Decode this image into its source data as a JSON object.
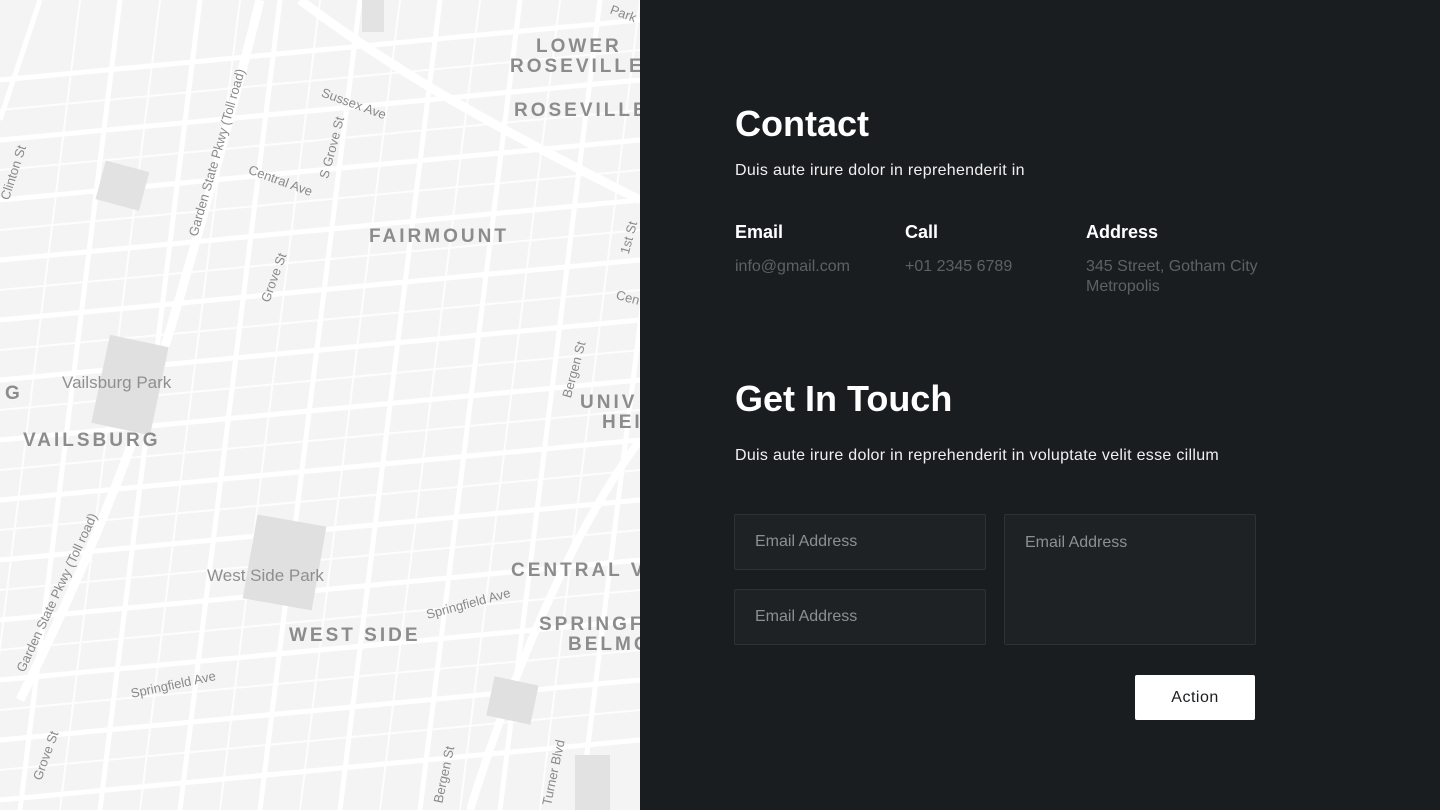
{
  "map": {
    "areas": [
      "LOWER",
      "ROSEVILLE",
      "ROSEVILLE",
      "FAIRMOUNT",
      "VAILSBURG",
      "CENTRAL V",
      "WEST SIDE",
      "SPRINGF",
      "BELMO",
      "UNIV",
      "HEI",
      "G"
    ],
    "parks": [
      "Vailsburg Park",
      "West Side Park"
    ],
    "streets": [
      "Park",
      "Sussex Ave",
      "S Grove St",
      "Garden State Pkwy (Toll road)",
      "Central Ave",
      "Clinton St",
      "Grove St",
      "1st St",
      "Cen",
      "Bergen St",
      "Springfield Ave",
      "Garden State Pkwy (Toll road)",
      "Springfield Ave",
      "Grove St",
      "Bergen St",
      "Turner Blvd"
    ]
  },
  "contact": {
    "title": "Contact",
    "subtitle": "Duis aute irure dolor in reprehenderit in",
    "email_label": "Email",
    "email_value": "info@gmail.com",
    "call_label": "Call",
    "call_value": "+01 2345 6789",
    "address_label": "Address",
    "address_line1": "345 Street, Gotham City",
    "address_line2": "Metropolis"
  },
  "touch": {
    "title": "Get In Touch",
    "subtitle": "Duis aute irure dolor in reprehenderit in voluptate velit esse cillum",
    "field1_placeholder": "Email Address",
    "field2_placeholder": "Email Address",
    "field3_placeholder": "Email Address",
    "action_label": "Action"
  }
}
